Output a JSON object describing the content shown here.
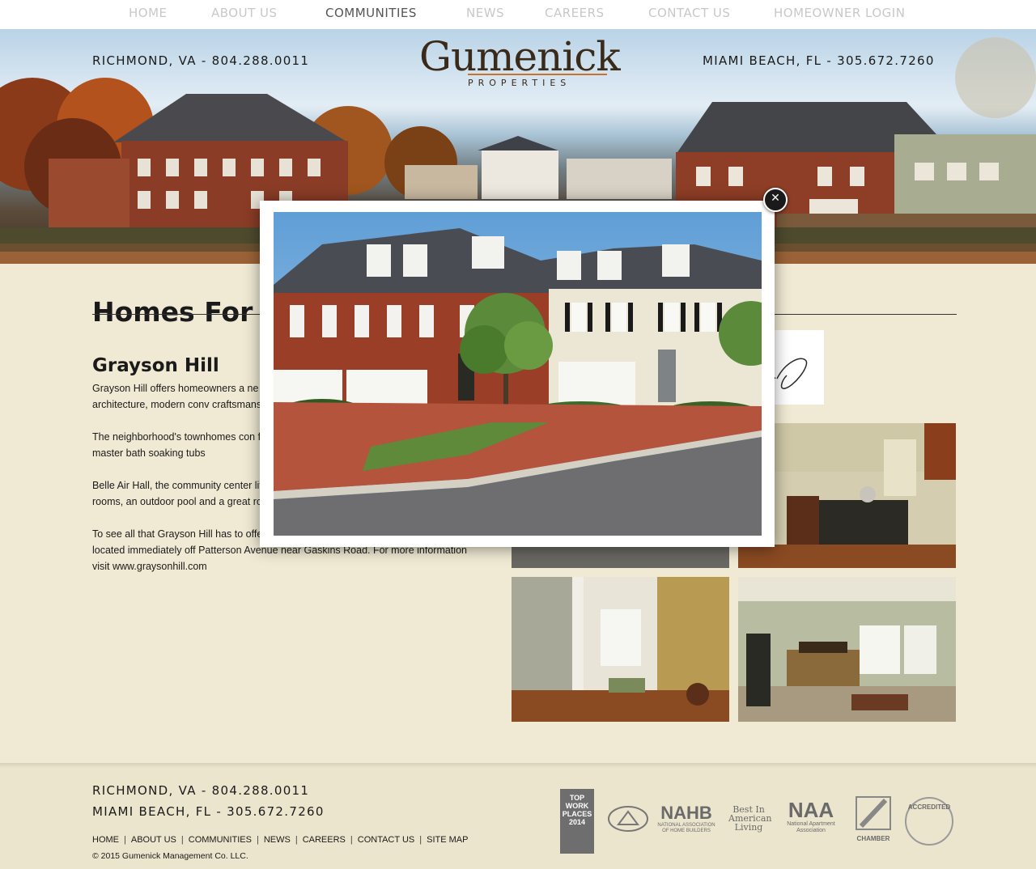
{
  "nav": {
    "items": [
      {
        "label": "HOME"
      },
      {
        "label": "ABOUT US"
      },
      {
        "label": "COMMUNITIES"
      },
      {
        "label": "NEWS"
      },
      {
        "label": "CAREERS"
      },
      {
        "label": "CONTACT US"
      },
      {
        "label": "HOMEOWNER LOGIN"
      }
    ],
    "active": "COMMUNITIES"
  },
  "header": {
    "contact_left": "RICHMOND, VA - 804.288.0011",
    "contact_right": "MIAMI BEACH, FL - 305.672.7260",
    "logo_main": "Gumenick",
    "logo_sub": "PROPERTIES"
  },
  "main": {
    "title": "Homes For",
    "subtitle": "Grayson Hill",
    "paragraphs": [
      "Grayson Hill offers homeowners a ne western Henrico County, this award Southern architecture, modern conv craftsmanship.",
      "The neighborhood's townhomes con first floor master suites. Standard h fireplaces, master bath soaking tubs",
      "Belle Air Hall, the community center life. The center has a fitness center, changing rooms, an outdoor pool and a great room and kitchen for entertaining.",
      "To see all that Grayson Hill has to offer, visit the Sales Center and furnished models located immediately off Patterson Avenue near Gaskins Road. For more information visit www.graysonhill.com"
    ]
  },
  "lightbox": {
    "close_icon": "close-icon",
    "image_alt": "Grayson Hill townhomes exterior"
  },
  "footer": {
    "contact_1": "RICHMOND, VA - 804.288.0011",
    "contact_2": "MIAMI BEACH, FL - 305.672.7260",
    "links": [
      "HOME",
      "ABOUT US",
      "COMMUNITIES",
      "NEWS",
      "CAREERS",
      "CONTACT US",
      "SITE MAP"
    ],
    "copyright": "© 2015 Gumenick Management Co. LLC.",
    "badges": {
      "top_workplaces": "TOP WORK PLACES 2014",
      "nahb": "NAHB",
      "nahb_sub": "NATIONAL ASSOCIATION OF HOME BUILDERS",
      "best_in": "Best In American Living",
      "naa": "NAA",
      "naa_sub": "National Apartment Association",
      "chamber": "CHAMBER",
      "accredited": "ACCREDITED"
    }
  },
  "colors": {
    "page_bg": "#f0ead4",
    "nav_inactive": "#c8c8c8",
    "nav_active": "#555555",
    "logo_accent": "#c8722a"
  }
}
